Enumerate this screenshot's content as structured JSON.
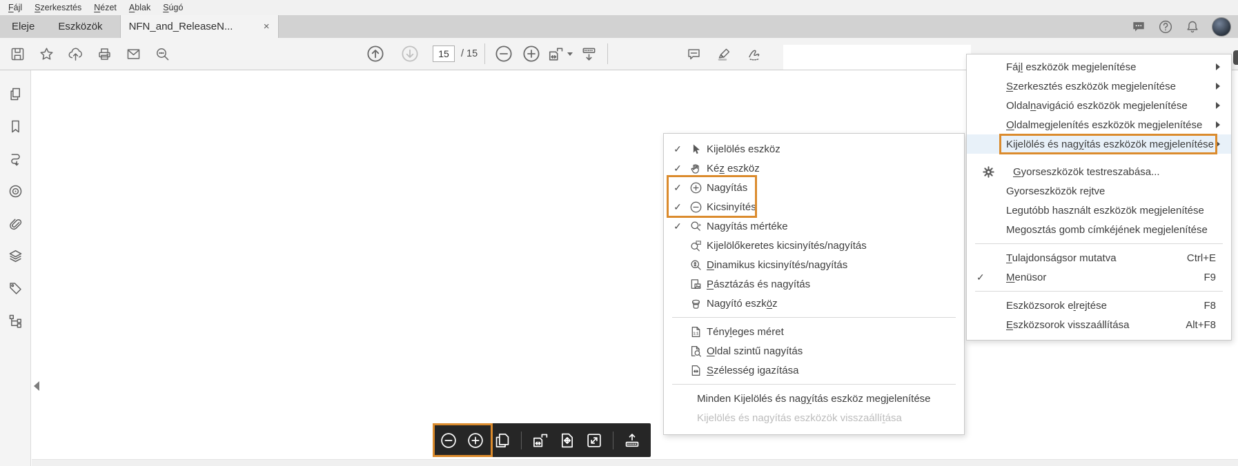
{
  "colors": {
    "accent": "#DB8B2D",
    "menu_highlight": "#E8F1F9",
    "toolbar_bg": "#F3F3F3",
    "tabbar_bg": "#D2D2D2",
    "dark_toolbar_bg": "#262626"
  },
  "menubar": {
    "items": [
      {
        "id": "file",
        "label": [
          [
            "F"
          ],
          "ájl"
        ]
      },
      {
        "id": "edit",
        "label": [
          [
            "S"
          ],
          "zerkesztés"
        ]
      },
      {
        "id": "view",
        "label": [
          [
            "N"
          ],
          "ézet"
        ]
      },
      {
        "id": "window",
        "label": [
          [
            "A"
          ],
          "blak"
        ]
      },
      {
        "id": "help",
        "label": [
          [
            "S"
          ],
          "úgó"
        ]
      }
    ]
  },
  "tabbar": {
    "tabs": [
      {
        "id": "home",
        "label": "Eleje",
        "active": false
      },
      {
        "id": "tools",
        "label": "Eszközök",
        "active": false
      },
      {
        "id": "document",
        "label": "NFN_and_ReleaseN...",
        "active": true,
        "close": "×"
      }
    ],
    "right_icons": [
      {
        "type": "icon",
        "icon": "chat-filled-icon",
        "name": "feedback-button"
      },
      {
        "type": "icon",
        "icon": "help-circle-icon",
        "name": "help-button"
      },
      {
        "type": "icon",
        "icon": "bell-icon",
        "name": "notifications-button"
      },
      {
        "type": "avatar",
        "name": "user-avatar"
      }
    ]
  },
  "toolbar": {
    "left": [
      {
        "icon": "save-icon",
        "name": "save-button"
      },
      {
        "icon": "star-icon",
        "name": "favorites-button"
      },
      {
        "icon": "share-icon",
        "name": "share-button"
      },
      {
        "icon": "print-icon",
        "name": "print-button"
      },
      {
        "icon": "email-icon",
        "name": "email-button"
      },
      {
        "icon": "search-icon",
        "name": "search-button"
      }
    ],
    "center": [
      {
        "type": "icon",
        "icon": "arrow-up-circle-icon",
        "name": "previous-page-button",
        "size": 28
      },
      {
        "type": "icon",
        "icon": "arrow-down-circle-icon",
        "name": "next-page-button",
        "disabled": true,
        "size": 28,
        "extra": "sp16"
      },
      {
        "type": "page-input",
        "value": "15",
        "name": "page-number-input"
      },
      {
        "type": "label",
        "text": "/ 15",
        "name": "page-count-label"
      },
      {
        "type": "divider"
      },
      {
        "type": "icon",
        "icon": "zoom-out-circle-icon",
        "name": "zoom-out-button",
        "size": 28
      },
      {
        "type": "icon",
        "icon": "zoom-in-circle-icon",
        "name": "zoom-in-button",
        "size": 28,
        "extra": "sp6"
      },
      {
        "type": "icon",
        "icon": "page-fit-icon",
        "name": "page-fit-button",
        "caret": true,
        "size": 25,
        "extra": "sp6"
      },
      {
        "type": "icon",
        "icon": "dock-toolbar-icon",
        "name": "hide-toolbar-button",
        "size": 25,
        "extra": "sp6"
      },
      {
        "type": "divider"
      }
    ],
    "annot": [
      {
        "icon": "comment-icon",
        "name": "comment-button"
      },
      {
        "icon": "highlighter-icon",
        "name": "highlight-button"
      },
      {
        "icon": "sign-pen-icon",
        "name": "fill-sign-button"
      }
    ]
  },
  "sidebar": {
    "icons": [
      {
        "icon": "page-thumbnails-icon",
        "name": "panel-page-thumbnails-button"
      },
      {
        "icon": "bookmarks-icon",
        "name": "panel-bookmarks-button"
      },
      {
        "icon": "articles-icon",
        "name": "panel-articles-button"
      },
      {
        "icon": "destinations-icon",
        "name": "panel-destinations-button"
      },
      {
        "icon": "attachments-icon",
        "name": "panel-attachments-button"
      },
      {
        "icon": "layers-icon",
        "name": "panel-layers-button"
      },
      {
        "icon": "tags-icon",
        "name": "panel-tags-button"
      },
      {
        "icon": "content-order-icon",
        "name": "panel-order-button"
      }
    ]
  },
  "context_menu": {
    "items": [
      {
        "id": "select-tool",
        "icon": "cursor-icon",
        "checked": true,
        "label": [
          "Kijelölés eszköz"
        ]
      },
      {
        "id": "hand-tool",
        "icon": "hand-icon",
        "checked": true,
        "label": [
          "Ké",
          [
            "z"
          ],
          " eszköz"
        ]
      },
      {
        "id": "zoom-in-tool",
        "icon": "zoom-in-circle-icon",
        "checked": true,
        "label": [
          "Nagyítás"
        ]
      },
      {
        "id": "zoom-out-tool",
        "icon": "zoom-out-circle-icon",
        "checked": true,
        "label": [
          "Kicsinyítés"
        ]
      },
      {
        "id": "zoom-value",
        "icon": "magnifier-caret-icon",
        "checked": true,
        "label": [
          "Nagyítás mértéke"
        ]
      },
      {
        "id": "marquee-zoom",
        "icon": "magnifier-marquee-icon",
        "checked": false,
        "label": [
          "Kijelölőkeretes kicsinyítés/nagyítás"
        ]
      },
      {
        "id": "dynamic-zoom",
        "icon": "magnifier-dynamic-icon",
        "checked": false,
        "label": [
          [
            "D"
          ],
          "inamikus kicsinyítés/nagyítás"
        ]
      },
      {
        "id": "pan-zoom",
        "icon": "pan-zoom-icon",
        "checked": false,
        "label": [
          [
            "P"
          ],
          "ásztázás és nagyítás"
        ]
      },
      {
        "id": "loupe-tool",
        "icon": "loupe-icon",
        "checked": false,
        "label": [
          "Nagyító eszk",
          [
            "ö"
          ],
          "z"
        ]
      },
      {
        "type": "separator"
      },
      {
        "id": "actual-size",
        "icon": "actual-size-icon",
        "checked": false,
        "label": [
          "Tény",
          [
            "l"
          ],
          "eges méret"
        ]
      },
      {
        "id": "zoom-to-page",
        "icon": "page-zoom-icon",
        "checked": false,
        "label": [
          [
            "O"
          ],
          "ldal szintű nagyítás"
        ]
      },
      {
        "id": "fit-width",
        "icon": "fit-width-icon",
        "checked": false,
        "label": [
          [
            "S"
          ],
          "zélesség igazítása"
        ]
      },
      {
        "type": "separator"
      },
      {
        "id": "show-all-select-zoom",
        "no_icon": true,
        "label": [
          "Minden Kijelölés és nag",
          [
            "y"
          ],
          "ítás eszköz megjelenítése"
        ]
      },
      {
        "id": "reset-select-zoom",
        "no_icon": true,
        "disabled": true,
        "label": [
          "Kijelölés és nagyítás eszközök visszaállí",
          [
            "t"
          ],
          "ása"
        ]
      }
    ]
  },
  "tools_menu": {
    "items": [
      {
        "id": "file-tools",
        "label": [
          "Fá",
          [
            "jl"
          ],
          " eszközök megjelenítése"
        ],
        "submenu": true
      },
      {
        "id": "edit-tools",
        "label": [
          [
            "S"
          ],
          "zerkesztés eszközök megjelenítése"
        ],
        "submenu": true
      },
      {
        "id": "page-nav-tools",
        "label": [
          "Oldal",
          [
            "n"
          ],
          "avigáció eszközök megjelenítése"
        ],
        "submenu": true
      },
      {
        "id": "page-display-tools",
        "label": [
          [
            "O"
          ],
          "ldalmegjelenítés eszközök megjelenítése"
        ],
        "submenu": true
      },
      {
        "id": "select-zoom-tools",
        "label": [
          "Kijelölés és nag",
          [
            "y"
          ],
          "ítás eszközök megjelenítése"
        ],
        "submenu": true,
        "highlighted": true,
        "highlight_box": true
      },
      {
        "type": "spacer"
      },
      {
        "id": "customize-quick-tools",
        "icon": "gear-icon",
        "label": [
          [
            "G"
          ],
          "yorseszközök testreszabása..."
        ]
      },
      {
        "id": "quick-tools-hidden",
        "label": [
          "Gyorseszközök rejtve"
        ]
      },
      {
        "id": "recent-tools",
        "label": [
          "Legutóbb használt eszközök megjelenítése"
        ]
      },
      {
        "id": "share-button-label",
        "label": [
          "Megosztás gomb címkéjének megjelenítése"
        ]
      },
      {
        "type": "separator"
      },
      {
        "id": "properties-bar",
        "label": [
          [
            "T"
          ],
          "ulajdonságsor mutatva"
        ],
        "shortcut": "Ctrl+E"
      },
      {
        "id": "menu-bar-toggle",
        "label": [
          [
            "M"
          ],
          "enüsor"
        ],
        "checked": true,
        "shortcut": "F9"
      },
      {
        "type": "separator"
      },
      {
        "id": "hide-toolbars",
        "label": [
          "Eszközsorok e",
          [
            "l"
          ],
          "rejtése"
        ],
        "shortcut": "F8"
      },
      {
        "id": "reset-toolbars",
        "label": [
          [
            "E"
          ],
          "szközsorok visszaállítása"
        ],
        "shortcut": "Alt+F8"
      }
    ]
  },
  "floating_toolbar": {
    "items": [
      {
        "type": "icon",
        "icon": "zoom-out-circle-icon",
        "name": "fab-zoom-out-button"
      },
      {
        "type": "icon",
        "icon": "zoom-in-circle-icon",
        "name": "fab-zoom-in-button"
      },
      {
        "type": "icon",
        "icon": "pages-copy-icon",
        "name": "fab-page-view-button"
      },
      {
        "type": "divider"
      },
      {
        "type": "icon",
        "icon": "page-fit-icon",
        "name": "fab-fit-width-button"
      },
      {
        "type": "icon",
        "icon": "page-arrows-icon",
        "name": "fab-zoom-pan-button"
      },
      {
        "type": "icon",
        "icon": "expand-icon",
        "name": "fab-fullscreen-button"
      },
      {
        "type": "divider"
      },
      {
        "type": "icon",
        "icon": "dock-up-icon",
        "name": "fab-show-toolbar-button"
      }
    ]
  },
  "checkmark_glyph": "✓"
}
